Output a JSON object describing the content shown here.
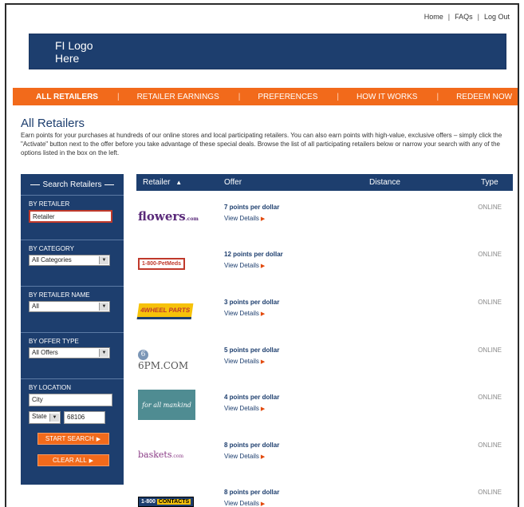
{
  "top_links": [
    "Home",
    "FAQs",
    "Log Out"
  ],
  "logo": {
    "text": "FI Logo\nHere"
  },
  "nav": {
    "items": [
      "ALL RETAILERS",
      "RETAILER EARNINGS",
      "PREFERENCES",
      "HOW IT WORKS",
      "REDEEM NOW"
    ],
    "active_index": 0
  },
  "page": {
    "title": "All Retailers",
    "intro": "Earn points for your purchases at hundreds of our online stores and local participating retailers. You can also earn points with high-value, exclusive offers – simply click the \"Activate\" button next to the offer before you take advantage of these special deals. Browse the list of all participating retailers below or narrow your search with any of the options listed in the box on the left."
  },
  "sidebar": {
    "title": "Search Retailers",
    "by_retailer": {
      "label": "BY RETAILER",
      "value": "Retailer"
    },
    "by_category": {
      "label": "BY CATEGORY",
      "value": "All Categories"
    },
    "by_retailer_name": {
      "label": "BY RETAILER NAME",
      "value": "All"
    },
    "by_offer_type": {
      "label": "BY OFFER TYPE",
      "value": "All Offers"
    },
    "by_location": {
      "label": "BY LOCATION",
      "city": "City",
      "state": "State",
      "zip": "68106"
    },
    "start_search": "START SEARCH",
    "clear_all": "CLEAR ALL"
  },
  "table": {
    "headers": {
      "retailer": "Retailer",
      "offer": "Offer",
      "distance": "Distance",
      "type": "Type"
    },
    "view_details": "View Details",
    "rows": [
      {
        "retailer": "1-800-flowers.com",
        "logo_text": "flowers",
        "offer": "7 points per dollar",
        "type": "ONLINE"
      },
      {
        "retailer": "1-800-PetMeds",
        "logo_text": "1-800-PetMeds",
        "offer": "12 points per dollar",
        "type": "ONLINE"
      },
      {
        "retailer": "4 Wheel Parts",
        "logo_text": "4WHEEL PARTS",
        "offer": "3 points per dollar",
        "type": "ONLINE"
      },
      {
        "retailer": "6PM.COM",
        "logo_text": "6PM.COM",
        "offer": "5 points per dollar",
        "type": "ONLINE"
      },
      {
        "retailer": "for all 7 mankind",
        "logo_text": "for all mankind",
        "offer": "4 points per dollar",
        "type": "ONLINE"
      },
      {
        "retailer": "1-800-baskets.com",
        "logo_text": "baskets",
        "offer": "8 points per dollar",
        "type": "ONLINE"
      },
      {
        "retailer": "1-800 CONTACTS",
        "logo_text": "CONTACTS",
        "offer": "8 points per dollar",
        "type": "ONLINE"
      }
    ]
  },
  "colors": {
    "navy": "#1d3e6e",
    "orange": "#f26a1b",
    "accent_red": "#e24a0e"
  }
}
